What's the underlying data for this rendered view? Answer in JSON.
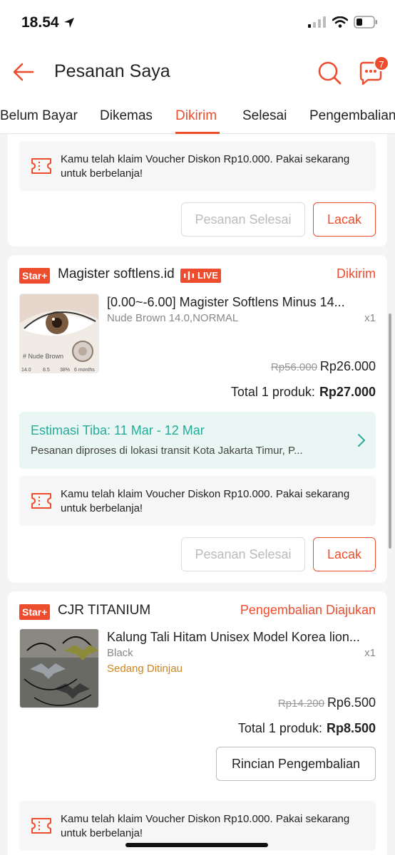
{
  "status_bar": {
    "time": "18.54"
  },
  "header": {
    "title": "Pesanan Saya",
    "chat_badge": "7"
  },
  "tabs": [
    {
      "label": "Belum Bayar"
    },
    {
      "label": "Dikemas"
    },
    {
      "label": "Dikirim",
      "active": true
    },
    {
      "label": "Selesai"
    },
    {
      "label": "Pengembalian"
    }
  ],
  "orders": [
    {
      "voucher_text": "Kamu telah klaim Voucher Diskon Rp10.000. Pakai sekarang untuk berbelanja!",
      "buttons": {
        "secondary": "Pesanan Selesai",
        "primary": "Lacak"
      }
    },
    {
      "badge": "Star+",
      "shop_name": "Magister softlens.id",
      "live_label": "LIVE",
      "status": "Dikirim",
      "product": {
        "name": "[0.00~-6.00] Magister Softlens Minus 14...",
        "variant": "Nude Brown 14.0,NORMAL",
        "qty": "x1",
        "price_original": "Rp56.000",
        "price": "Rp26.000",
        "thumb_caption": "# Nude Brown",
        "thumb_specs": [
          "14.0",
          "8.5",
          "38%",
          "6 months"
        ]
      },
      "total_label": "Total 1 produk:",
      "total_value": "Rp27.000",
      "eta": {
        "title": "Estimasi Tiba: 11 Mar - 12 Mar",
        "desc": "Pesanan diproses di lokasi transit Kota Jakarta Timur, P..."
      },
      "voucher_text": "Kamu telah klaim Voucher Diskon Rp10.000. Pakai sekarang untuk berbelanja!",
      "buttons": {
        "secondary": "Pesanan Selesai",
        "primary": "Lacak"
      }
    },
    {
      "badge": "Star+",
      "shop_name": "CJR TITANIUM",
      "status": "Pengembalian Diajukan",
      "product": {
        "name": "Kalung Tali Hitam Unisex Model Korea lion...",
        "variant": "Black",
        "qty": "x1",
        "review_status": "Sedang Ditinjau",
        "price_original": "Rp14.200",
        "price": "Rp6.500"
      },
      "total_label": "Total 1 produk:",
      "total_value": "Rp8.500",
      "buttons": {
        "outline": "Rincian Pengembalian"
      },
      "voucher_text": "Kamu telah klaim Voucher Diskon Rp10.000. Pakai sekarang untuk berbelanja!"
    }
  ],
  "colors": {
    "accent": "#ee4d2d",
    "eta_text": "#26aa99",
    "review": "#d0841a"
  }
}
